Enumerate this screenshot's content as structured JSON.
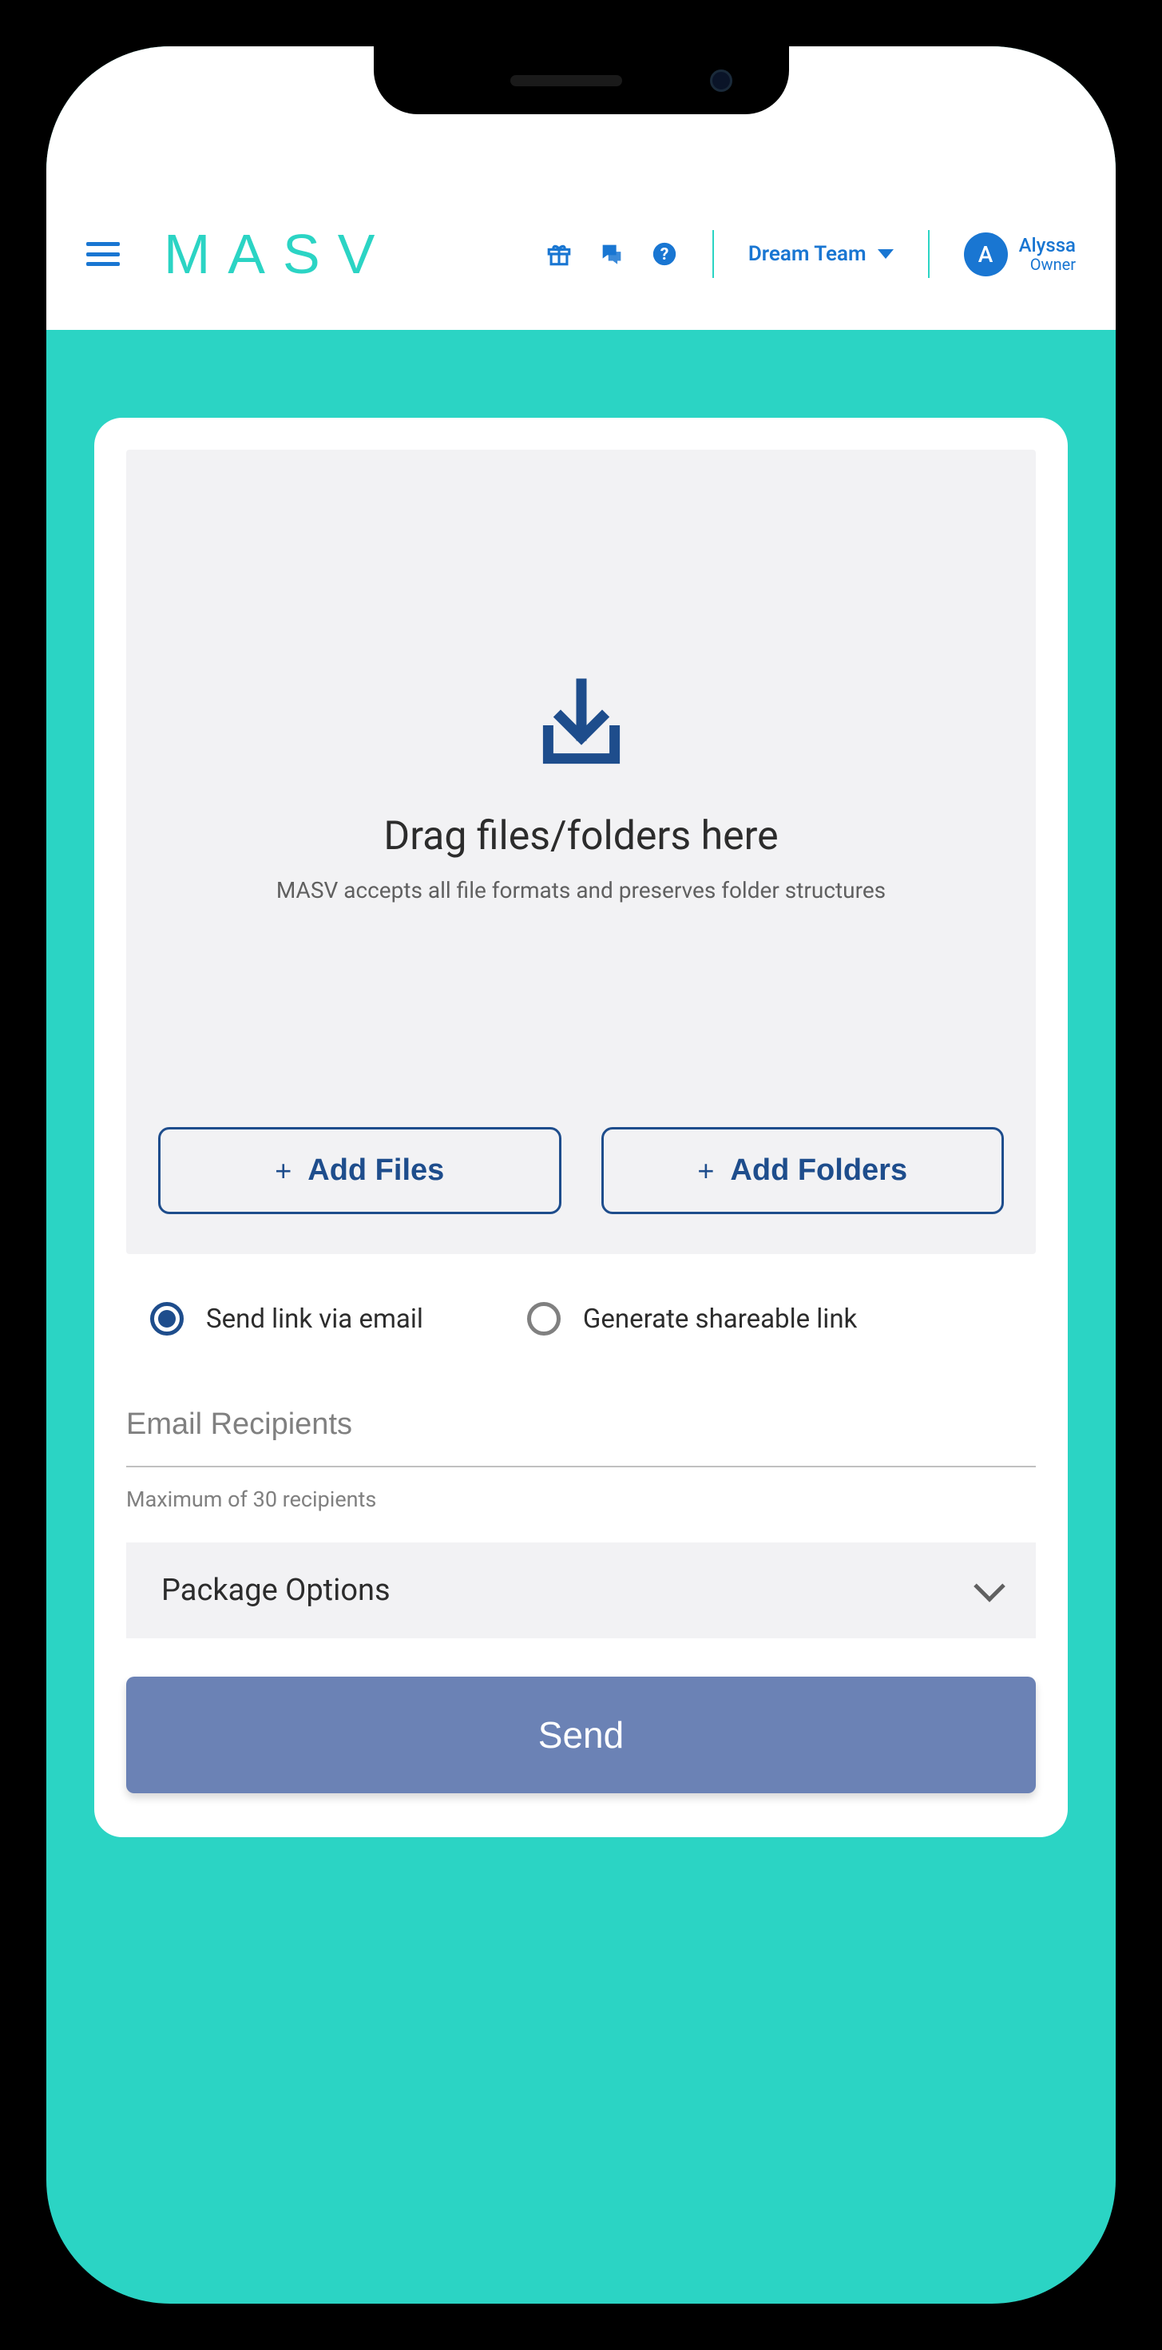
{
  "header": {
    "logo_text": "MASV",
    "team_name": "Dream Team",
    "user": {
      "initial": "A",
      "name": "Alyssa",
      "role": "Owner"
    }
  },
  "dropzone": {
    "title": "Drag files/folders here",
    "subtitle": "MASV accepts all file formats and preserves folder structures",
    "add_files_label": "Add Files",
    "add_folders_label": "Add Folders"
  },
  "delivery_options": {
    "email_label": "Send link via email",
    "shareable_label": "Generate shareable link",
    "selected": "email"
  },
  "email": {
    "placeholder": "Email Recipients",
    "hint": "Maximum of 30 recipients"
  },
  "package_options_label": "Package Options",
  "send_label": "Send"
}
